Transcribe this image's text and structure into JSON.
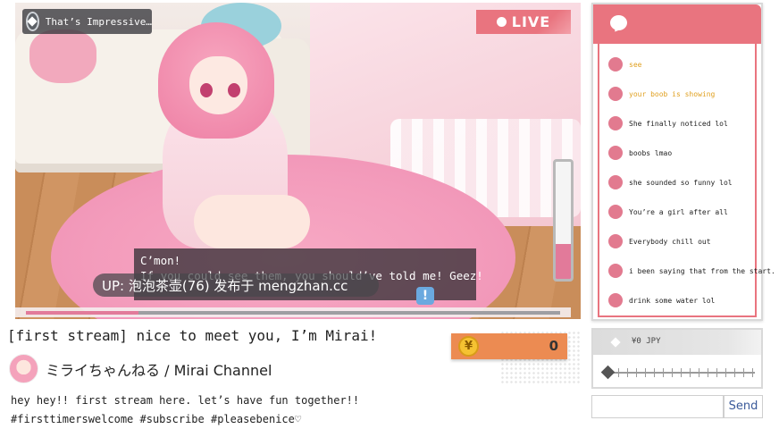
{
  "video": {
    "title_badge": "That’s Impressive…",
    "live_label": "LIVE",
    "meter_level": 0.3,
    "dialog": {
      "line1": "C’mon!",
      "line2": "If you could see them, you should’ve told me! Geez!"
    },
    "exclaim_icon": "!",
    "watermark": "UP: 泡泡茶壶(76) 发布于 mengzhan.cc",
    "progress": 0.21
  },
  "stream": {
    "title": "[first stream] nice to meet you, I’m Mirai!",
    "channel": "ミライちゃんねる / Mirai Channel",
    "description_line1": "hey hey!! first stream here. let’s have fun together!!",
    "description_line2": "#firsttimerswelcome #subscribe #pleasebenice♡"
  },
  "coins": {
    "icon": "¥",
    "value": "0"
  },
  "chat": {
    "messages": [
      {
        "text": "see",
        "highlight": true
      },
      {
        "text": "your boob is showing",
        "highlight": true
      },
      {
        "text": "She finally noticed lol",
        "highlight": false
      },
      {
        "text": "boobs lmao",
        "highlight": false
      },
      {
        "text": "she sounded so funny lol",
        "highlight": false
      },
      {
        "text": "You’re a girl after all",
        "highlight": false
      },
      {
        "text": "Everybody chill out",
        "highlight": false
      },
      {
        "text": "i been saying that from the start.",
        "highlight": false
      },
      {
        "text": "drink some water lol",
        "highlight": false
      }
    ]
  },
  "tip": {
    "amount_label": "¥0 JPY",
    "slider_value": 0
  },
  "send": {
    "input_value": "",
    "button_label": "Send"
  },
  "colors": {
    "accent": "#e9747f",
    "coin_bar": "#ec8b52",
    "chat_highlight": "#e0a020"
  }
}
